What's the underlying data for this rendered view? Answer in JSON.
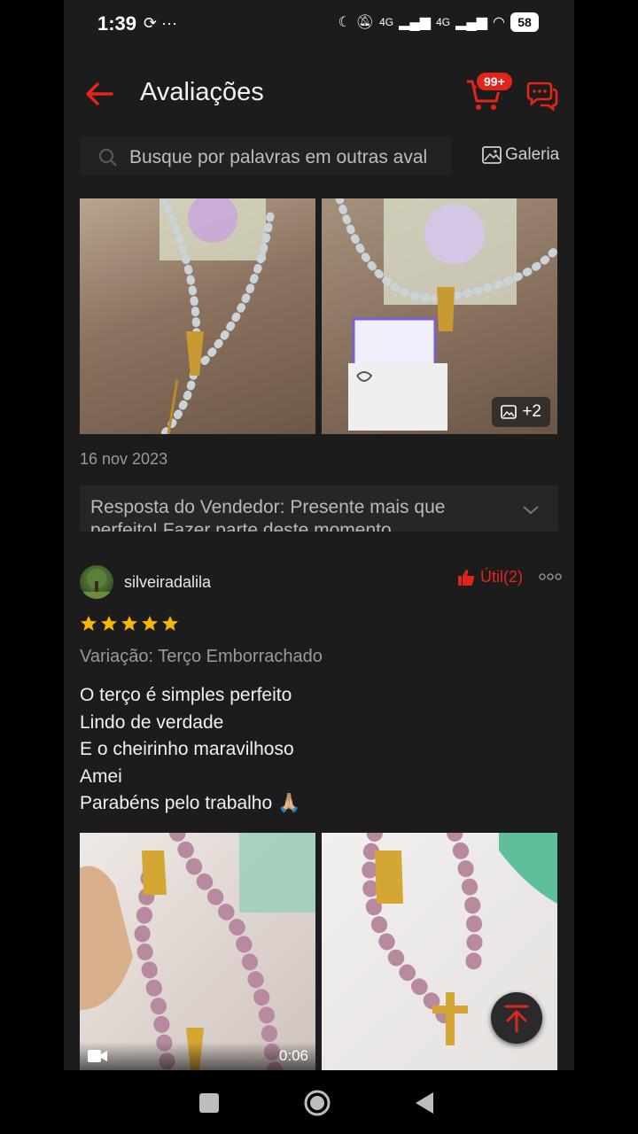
{
  "status_bar": {
    "time": "1:39",
    "left_icons": "⟳ ···",
    "network_1": "4G",
    "network_2": "4G",
    "battery": "58"
  },
  "header": {
    "title": "Avaliações",
    "cart_badge": "99+",
    "icons": [
      "back-arrow-icon",
      "cart-icon",
      "chat-icon"
    ]
  },
  "search": {
    "placeholder": "Busque por palavras em outras aval",
    "gallery_label": "Galeria"
  },
  "previous_review": {
    "photo_extra_count": "+2",
    "date": "16 nov 2023",
    "seller_reply": "Resposta do Vendedor: Presente mais que perfeito! Fazer parte deste momento"
  },
  "review": {
    "username": "silveiradalila",
    "helpful_label": "Útil(2)",
    "rating": 5,
    "rating_max": 5,
    "variation": "Variação: Terço Emborrachado",
    "lines": [
      "O terço é simples perfeito",
      "Lindo de verdade",
      "E o cheirinho maravilhoso",
      "Amei",
      "Parabéns pelo trabalho 🙏🏼"
    ],
    "video_duration": "0:06"
  },
  "colors": {
    "accent": "#e1251b",
    "background": "#1c1c1c",
    "star": "#f5b800"
  }
}
